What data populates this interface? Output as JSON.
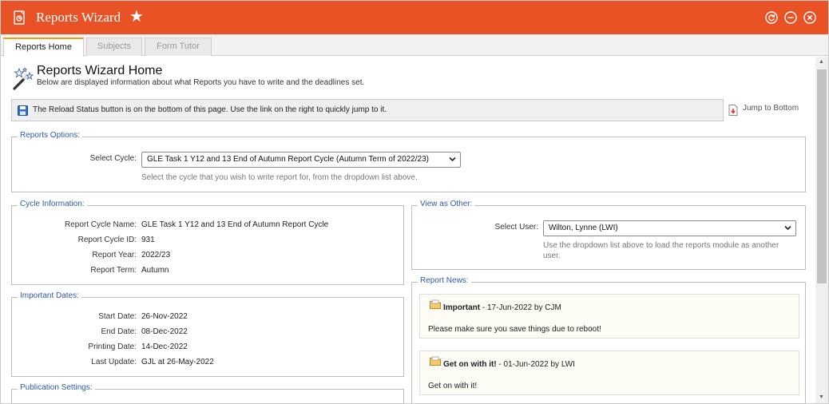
{
  "window": {
    "title": "Reports Wizard",
    "colors": {
      "title_bar": "#e95225",
      "legend_text": "#2e5aa8",
      "active_tab_accent": "#f39c12"
    },
    "icons": [
      "report-app-icon",
      "star-icon",
      "refresh-icon",
      "minimize-icon",
      "close-icon"
    ]
  },
  "tabs": [
    {
      "label": "Reports Home",
      "active": true
    },
    {
      "label": "Subjects",
      "active": false
    },
    {
      "label": "Form Tutor",
      "active": false
    }
  ],
  "header": {
    "title": "Reports Wizard Home",
    "subtitle": "Below are displayed information about what Reports you have to write and the deadlines set."
  },
  "notice": {
    "text": "The Reload Status button is on the bottom of this page. Use the link on the right to quickly jump to it.",
    "jump_label": "Jump to Bottom"
  },
  "reports_options": {
    "legend": "Reports Options:",
    "cycle_label": "Select Cycle:",
    "cycle_value": "GLE Task 1 Y12 and 13 End of Autumn Report Cycle (Autumn Term of 2022/23)",
    "hint": "Select the cycle that you wish to write report for, from the dropdown list above."
  },
  "cycle_info": {
    "legend": "Cycle Information:",
    "rows": [
      {
        "label": "Report Cycle Name:",
        "value": "GLE Task 1 Y12 and 13 End of Autumn Report Cycle"
      },
      {
        "label": "Report Cycle ID:",
        "value": "931"
      },
      {
        "label": "Report Year:",
        "value": "2022/23"
      },
      {
        "label": "Report Term:",
        "value": "Autumn"
      }
    ]
  },
  "important_dates": {
    "legend": "Important Dates:",
    "rows": [
      {
        "label": "Start Date:",
        "value": "26-Nov-2022"
      },
      {
        "label": "End Date:",
        "value": "08-Dec-2022"
      },
      {
        "label": "Printing Date:",
        "value": "14-Dec-2022"
      },
      {
        "label": "Last Update:",
        "value": "GJL at 26-May-2022"
      }
    ]
  },
  "publication": {
    "legend": "Publication Settings:"
  },
  "view_as_other": {
    "legend": "View as Other:",
    "user_label": "Select User:",
    "user_value": "Wilton, Lynne (LWI)",
    "hint": "Use the dropdown list above to load the reports module as another user."
  },
  "news": {
    "legend": "Report News:",
    "items": [
      {
        "title": "Important",
        "meta": " - 17-Jun-2022 by CJM",
        "body": "Please make sure you save things due to reboot!"
      },
      {
        "title": "Get on with it!",
        "meta": " - 01-Jun-2022 by LWI",
        "body": "Get on with it!"
      }
    ]
  }
}
